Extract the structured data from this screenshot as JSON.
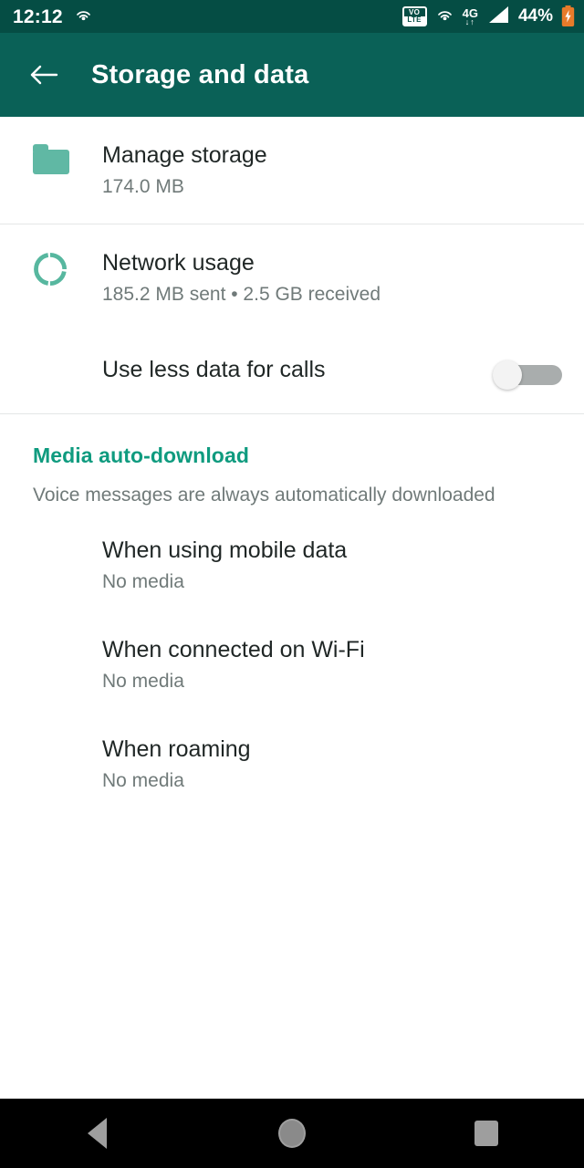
{
  "status_bar": {
    "clock": "12:12",
    "left_icon": "cast-icon",
    "volte_top": "VO",
    "volte_bottom": "LTE",
    "hotspot_icon": "cast-icon",
    "network_type": "4G",
    "network_arrows": "↓↑",
    "signal_icon": "signal-bars-icon",
    "battery_percent": "44%",
    "battery_icon": "battery-icon",
    "bg_color": "#054D44"
  },
  "app_bar": {
    "back_icon": "back-arrow-icon",
    "title": "Storage and data",
    "bg_color": "#0A6157"
  },
  "rows": {
    "manage_storage": {
      "icon": "folder-icon",
      "title": "Manage storage",
      "subtitle": "174.0 MB"
    },
    "network_usage": {
      "icon": "pie-chart-icon",
      "title": "Network usage",
      "subtitle": "185.2 MB sent • 2.5 GB received"
    },
    "use_less_data": {
      "title": "Use less data for calls",
      "toggle_state": "off"
    }
  },
  "media_section": {
    "title": "Media auto-download",
    "note": "Voice messages are always automatically downloaded",
    "accent_color": "#0F9B7F",
    "options": [
      {
        "title": "When using mobile data",
        "value": "No media"
      },
      {
        "title": "When connected on Wi-Fi",
        "value": "No media"
      },
      {
        "title": "When roaming",
        "value": "No media"
      }
    ]
  },
  "nav_bar": {
    "back": "nav-back-icon",
    "home": "nav-home-icon",
    "recents": "nav-recents-icon"
  }
}
